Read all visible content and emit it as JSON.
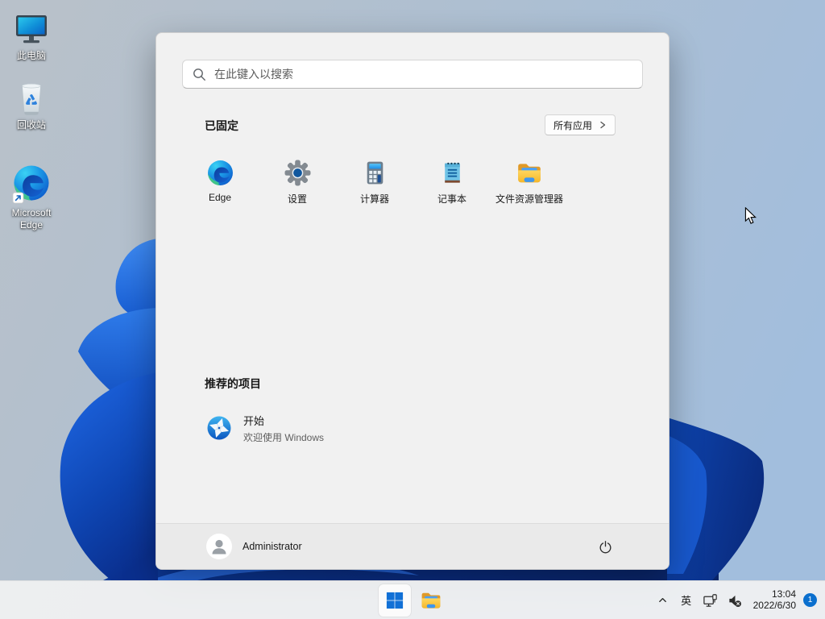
{
  "desktop": {
    "icons": [
      {
        "label": "此电脑"
      },
      {
        "label": "回收站"
      },
      {
        "label": "Microsoft Edge"
      }
    ]
  },
  "start_menu": {
    "search_placeholder": "在此键入以搜索",
    "pinned_section": {
      "title": "已固定",
      "all_apps_label": "所有应用"
    },
    "pinned_apps": [
      {
        "label": "Edge"
      },
      {
        "label": "设置"
      },
      {
        "label": "计算器"
      },
      {
        "label": "记事本"
      },
      {
        "label": "文件资源管理器"
      }
    ],
    "recommended_section": {
      "title": "推荐的项目"
    },
    "recommended_items": [
      {
        "title": "开始",
        "subtitle": "欢迎使用 Windows"
      }
    ],
    "user_name": "Administrator"
  },
  "taskbar": {
    "ime_label": "英",
    "clock": {
      "time": "13:04",
      "date": "2022/6/30"
    },
    "notification_badge": "1"
  },
  "icons": {
    "search": "magnifier-icon",
    "all_apps": "chevron-right-icon",
    "user": "person-icon",
    "power": "power-icon",
    "start": "windows-logo-icon",
    "explorer": "folder-icon",
    "tray": [
      "chevron-up-icon",
      "ethernet-icon",
      "volume-muted-icon"
    ]
  },
  "colors": {
    "accent": "#1170d6",
    "menu_bg": "#f1f1f1",
    "taskbar_bg": "#f3f3f3",
    "badge": "#0b6fce",
    "bloom_bright": "#2f7ceb",
    "bloom_dark": "#0a2f8e"
  }
}
